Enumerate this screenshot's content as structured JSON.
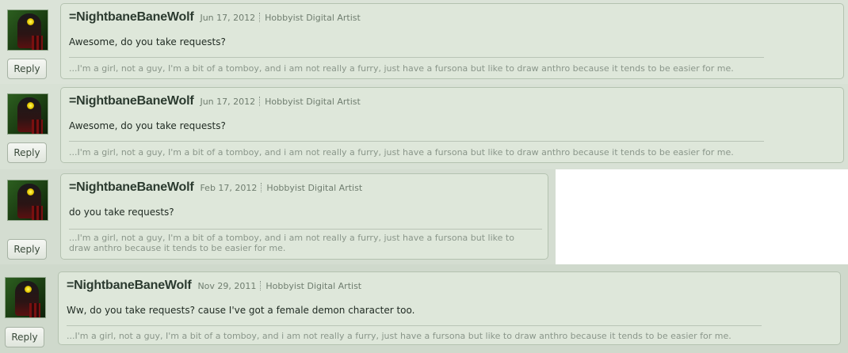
{
  "reply_label": "Reply",
  "comments": [
    {
      "username": "=NightbaneBaneWolf",
      "date": "Jun 17, 2012",
      "role": "Hobbyist Digital Artist",
      "message": "Awesome, do you take requests?",
      "signature": "...I'm a girl, not a guy, I'm a bit of a tomboy, and i am not really a furry, just have a fursona but like to draw anthro because it tends to be easier for me."
    },
    {
      "username": "=NightbaneBaneWolf",
      "date": "Jun 17, 2012",
      "role": "Hobbyist Digital Artist",
      "message": "Awesome, do you take requests?",
      "signature": "...I'm a girl, not a guy, I'm a bit of a tomboy, and i am not really a furry, just have a fursona but like to draw anthro because it tends to be easier for me."
    },
    {
      "username": "=NightbaneBaneWolf",
      "date": "Feb 17, 2012",
      "role": "Hobbyist Digital Artist",
      "message": "do you take requests?",
      "signature_line1": "...I'm a girl, not a guy, I'm a bit of a tomboy, and i am not really a furry, just have a fursona but like to",
      "signature_line2": "draw anthro because it tends to be easier for me."
    },
    {
      "username": "=NightbaneBaneWolf",
      "date": "Nov 29, 2011",
      "role": "Hobbyist Digital Artist",
      "message": "Ww, do you take requests? cause I've got a female demon character too.",
      "signature": "...I'm a girl, not a guy, I'm a bit of a tomboy, and i am not really a furry, just have a fursona but like to draw anthro because it tends to be easier for me."
    }
  ]
}
